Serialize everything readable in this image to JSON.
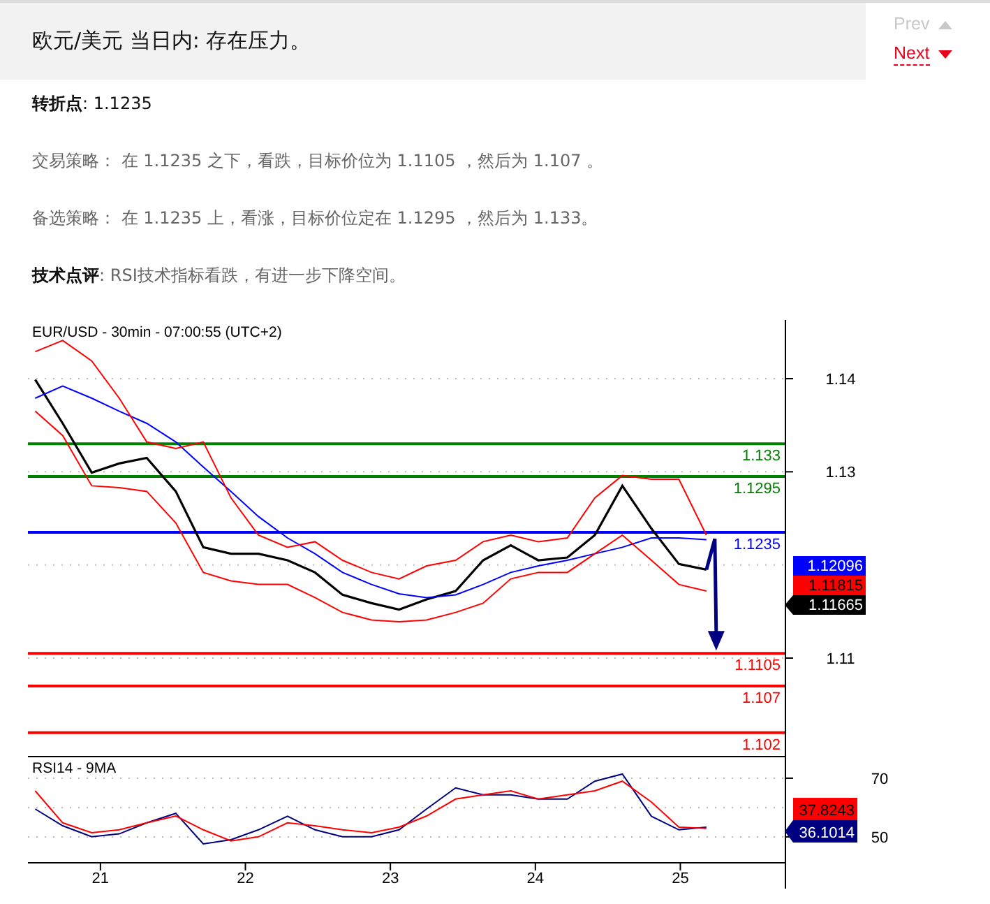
{
  "header": {
    "title": "欧元/美元 当日内: 存在压力。"
  },
  "nav": [
    {
      "label": "Prev",
      "kind": "up",
      "disabled": true
    },
    {
      "label": "Next",
      "kind": "down",
      "disabled": false
    }
  ],
  "paragraphs": [
    {
      "text": "**转折点**: 1.1235",
      "emphasis": true
    },
    {
      "text": "交易策略： 在 1.1235 之下，看跌，目标价位为 1.1105 ，然后为 1.107 。",
      "emphasis": false
    },
    {
      "text": "备选策略： 在 1.1235 上，看涨，目标价位定在 1.1295 ，然后为 1.133。",
      "emphasis": false
    },
    {
      "text": "**技术点评**: RSI技术指标看跌，有进一步下降空间。",
      "emphasis": false
    }
  ],
  "charts": [
    {
      "chart_data": {
        "type": "line",
        "title": "EUR/USD - 30min - 07:00:55 (UTC+2)",
        "x": [
          20.55,
          20.74,
          20.94,
          21.13,
          21.32,
          21.52,
          21.71,
          21.9,
          22.09,
          22.29,
          22.48,
          22.67,
          22.87,
          23.06,
          23.25,
          23.45,
          23.64,
          23.83,
          24.02,
          24.22,
          24.41,
          24.6,
          24.8,
          24.99,
          25.18
        ],
        "series": [
          {
            "color": "#000000",
            "values": [
              1.1399,
              1.1352,
              1.1299,
              1.1309,
              1.1315,
              1.1279,
              1.1219,
              1.1212,
              1.1212,
              1.1205,
              1.1192,
              1.1168,
              1.1159,
              1.1152,
              1.1163,
              1.1172,
              1.1205,
              1.1221,
              1.1205,
              1.1208,
              1.1232,
              1.1285,
              1.1239,
              1.1201,
              1.1195
            ]
          },
          {
            "color": "#0000ff",
            "values": [
              1.1379,
              1.1392,
              1.1379,
              1.1365,
              1.1352,
              1.1332,
              1.1305,
              1.1279,
              1.1252,
              1.1229,
              1.1212,
              1.1192,
              1.1179,
              1.1169,
              1.1165,
              1.1168,
              1.1179,
              1.1192,
              1.1199,
              1.1205,
              1.1212,
              1.1219,
              1.1229,
              1.1229,
              1.1227
            ]
          },
          {
            "color": "#ff0000",
            "values": [
              1.1429,
              1.1441,
              1.1419,
              1.1379,
              1.1332,
              1.1325,
              1.1332,
              1.1272,
              1.1232,
              1.1219,
              1.1225,
              1.1205,
              1.1192,
              1.1185,
              1.1199,
              1.1205,
              1.1225,
              1.1232,
              1.1225,
              1.1229,
              1.1272,
              1.1296,
              1.1292,
              1.1292,
              1.1232
            ]
          },
          {
            "color": "#ff0000",
            "values": [
              1.1365,
              1.1339,
              1.1285,
              1.1283,
              1.1279,
              1.1245,
              1.1192,
              1.1183,
              1.1179,
              1.1179,
              1.1165,
              1.1149,
              1.1141,
              1.1139,
              1.1141,
              1.1149,
              1.1159,
              1.1185,
              1.1192,
              1.1192,
              1.1212,
              1.1232,
              1.1205,
              1.1179,
              1.1172
            ]
          }
        ],
        "xlim": [
          20.5,
          25.72
        ],
        "ylim": [
          1.0998,
          1.1463
        ],
        "yticks": [
          1.14,
          1.13,
          1.11
        ],
        "grid": true,
        "ref_lines": [
          {
            "axis": "y",
            "value": 1.133,
            "label": "1.133",
            "color": "#008000"
          },
          {
            "axis": "y",
            "value": 1.1295,
            "label": "1.1295",
            "color": "#008000"
          },
          {
            "axis": "y",
            "value": 1.1235,
            "label": "1.1235",
            "color": "#0000ff"
          },
          {
            "axis": "y",
            "value": 1.1105,
            "label": "1.1105",
            "color": "#ff0000"
          },
          {
            "axis": "y",
            "value": 1.107,
            "label": "1.107",
            "color": "#ff0000"
          },
          {
            "axis": "y",
            "value": 1.102,
            "label": "1.102",
            "color": "#ff0000"
          }
        ]
      },
      "tags": [
        {
          "label": "1.12096",
          "color": "#0000ff",
          "pointer": false
        },
        {
          "label": "1.11815",
          "color": "#ff0000",
          "pointer": false
        },
        {
          "label": "1.11665",
          "color": "#000000",
          "pointer": true
        }
      ]
    },
    {
      "chart_data": {
        "type": "line",
        "title": "RSI14 - 9MA",
        "x": [
          20.55,
          20.74,
          20.94,
          21.13,
          21.32,
          21.52,
          21.71,
          21.9,
          22.09,
          22.29,
          22.48,
          22.67,
          22.87,
          23.06,
          23.25,
          23.45,
          23.64,
          23.83,
          24.02,
          24.22,
          24.41,
          24.6,
          24.8,
          24.99,
          25.18
        ],
        "series": [
          {
            "color": "#000080",
            "values": [
              59.5,
              53.8,
              50,
              51,
              54.8,
              58,
              47.6,
              49,
              52.4,
              57,
              52.4,
              50,
              50,
              52.4,
              59.5,
              66.7,
              64.3,
              64.3,
              62.9,
              62.9,
              69,
              71.4,
              57,
              52.4,
              53.3
            ]
          },
          {
            "color": "#ff0000",
            "values": [
              65.7,
              54.8,
              51.4,
              52.4,
              54.8,
              57.1,
              52.4,
              48.6,
              50,
              54.8,
              53.8,
              52.4,
              51.4,
              53.3,
              57.1,
              62.9,
              64.3,
              65.7,
              62.9,
              64.3,
              65.7,
              69,
              61.9,
              53.3,
              52.9
            ]
          }
        ],
        "xlim": [
          20.5,
          25.72
        ],
        "ylim": [
          41.4,
          77.6
        ],
        "yticks": [
          50,
          70
        ],
        "grid": true,
        "xticks": [
          {
            "value": 21,
            "label": "21"
          },
          {
            "value": 22,
            "label": "22"
          },
          {
            "value": 23,
            "label": "23"
          },
          {
            "value": 24,
            "label": "24"
          },
          {
            "value": 25,
            "label": "25"
          }
        ]
      },
      "tags": [
        {
          "label": "37.8243",
          "color": "#ff0000",
          "pointer": false
        },
        {
          "label": "36.1014",
          "color": "#000080",
          "pointer": true
        }
      ]
    }
  ]
}
